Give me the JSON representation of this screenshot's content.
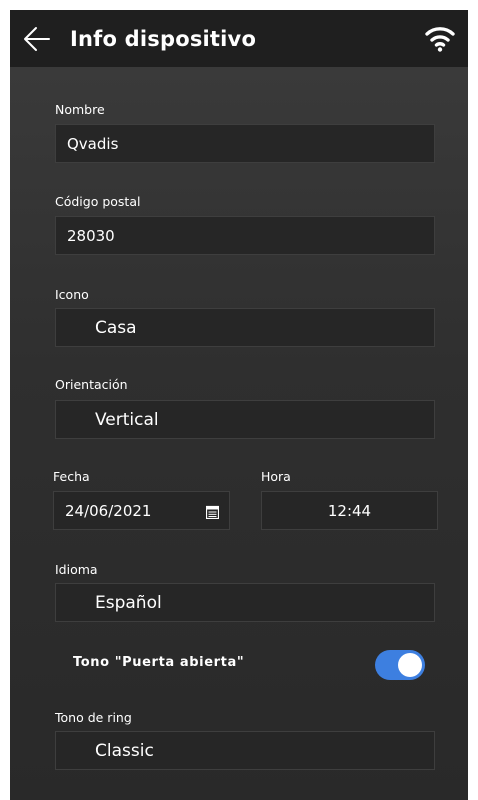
{
  "header": {
    "title": "Info dispositivo",
    "back_icon": "arrow-left-icon",
    "status_icon": "wifi-icon"
  },
  "form": {
    "nombre": {
      "label": "Nombre",
      "value": "Qvadis"
    },
    "codigo_postal": {
      "label": "Código postal",
      "value": "28030"
    },
    "icono": {
      "label": "Icono",
      "value": "Casa"
    },
    "orientacion": {
      "label": "Orientación",
      "value": "Vertical"
    },
    "fecha": {
      "label": "Fecha",
      "value": "24/06/2021",
      "icon": "calendar-icon"
    },
    "hora": {
      "label": "Hora",
      "value": "12:44"
    },
    "idioma": {
      "label": "Idioma",
      "value": "Español"
    },
    "tono_puerta": {
      "label": "Tono \"Puerta abierta\"",
      "enabled": true
    },
    "tono_ring": {
      "label": "Tono de ring",
      "value": "Classic"
    }
  },
  "colors": {
    "header_bg": "#1f1f1f",
    "field_bg": "#262626",
    "toggle_on": "#3d7fe0",
    "text": "#ffffff"
  }
}
